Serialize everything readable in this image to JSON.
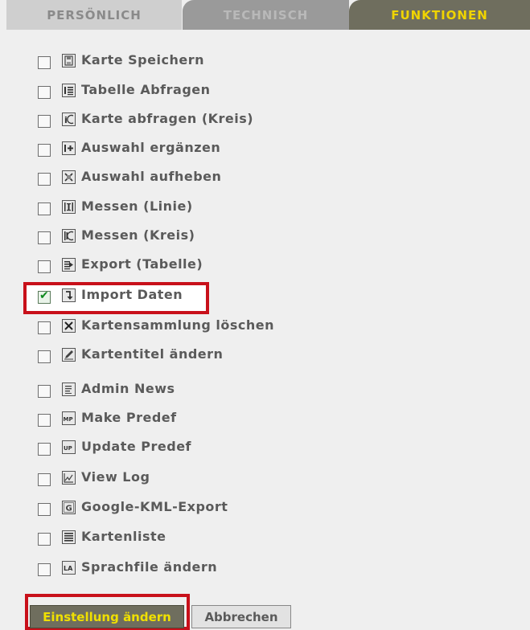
{
  "tabs": [
    {
      "label": "PERSÖNLICH"
    },
    {
      "label": "TECHNISCH"
    },
    {
      "label": "FUNKTIONEN"
    }
  ],
  "items": [
    {
      "label": "Karte Speichern",
      "icon": "save-icon",
      "checked": false
    },
    {
      "label": "Tabelle Abfragen",
      "icon": "table-query-icon",
      "checked": false
    },
    {
      "label": "Karte abfragen (Kreis)",
      "icon": "circle-query-icon",
      "checked": false
    },
    {
      "label": "Auswahl ergänzen",
      "icon": "add-selection-icon",
      "checked": false
    },
    {
      "label": "Auswahl aufheben",
      "icon": "clear-selection-icon",
      "checked": false
    },
    {
      "label": "Messen (Linie)",
      "icon": "measure-line-icon",
      "checked": false
    },
    {
      "label": "Messen (Kreis)",
      "icon": "measure-circle-icon",
      "checked": false
    },
    {
      "label": "Export (Tabelle)",
      "icon": "export-icon",
      "checked": false
    },
    {
      "label": "Import Daten",
      "icon": "import-icon",
      "checked": true
    },
    {
      "label": "Kartensammlung löschen",
      "icon": "delete-icon",
      "checked": false
    },
    {
      "label": "Kartentitel ändern",
      "icon": "edit-icon",
      "checked": false
    },
    {
      "label": "Admin News",
      "icon": "news-icon",
      "checked": false
    },
    {
      "label": "Make Predef",
      "icon": "make-predef-icon",
      "checked": false
    },
    {
      "label": "Update Predef",
      "icon": "update-predef-icon",
      "checked": false
    },
    {
      "label": "View Log",
      "icon": "log-icon",
      "checked": false
    },
    {
      "label": "Google-KML-Export",
      "icon": "google-kml-icon",
      "checked": false
    },
    {
      "label": "Kartenliste",
      "icon": "list-icon",
      "checked": false
    },
    {
      "label": "Sprachfile ändern",
      "icon": "language-icon",
      "checked": false
    }
  ],
  "icon_text": {
    "circle_query": "i",
    "make_predef": "MP",
    "update_predef": "UP",
    "google": "G",
    "language": "LA",
    "checkmark": "✔"
  },
  "buttons": {
    "apply": "Einstellung ändern",
    "cancel": "Abbrechen"
  },
  "colors": {
    "active_tab_bg": "#6f6e5e",
    "active_tab_text": "#f0d400",
    "highlight": "#c8101a",
    "check": "#0f8a1f"
  }
}
